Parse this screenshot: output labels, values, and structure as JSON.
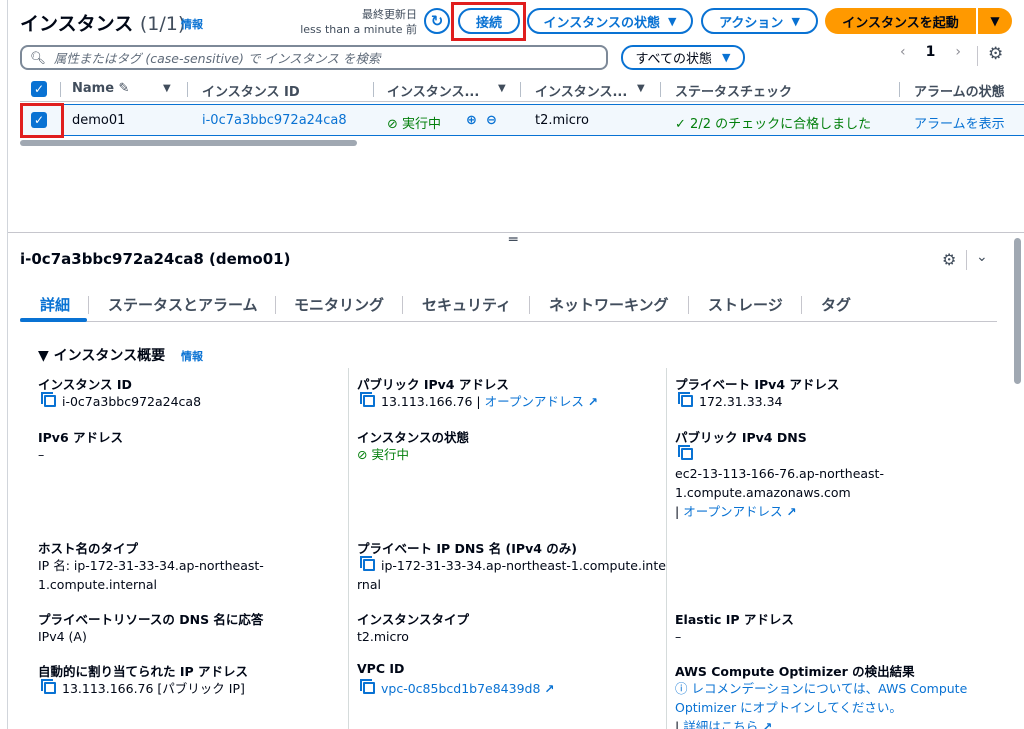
{
  "header": {
    "title": "インスタンス",
    "count": "(1/1)",
    "info": "情報",
    "last_updated_label": "最終更新日",
    "last_updated_value": "less than a minute 前",
    "connect": "接続",
    "instance_state": "インスタンスの状態",
    "actions": "アクション",
    "launch": "インスタンスを起動"
  },
  "filter": {
    "placeholder": "属性またはタグ (case-sensitive) で インスタンス を検索",
    "state_select": "すべての状態",
    "page": "1"
  },
  "table": {
    "columns": [
      "Name",
      "インスタンス ID",
      "インスタンス...",
      "インスタンス...",
      "ステータスチェック",
      "アラームの状態"
    ],
    "row": {
      "name": "demo01",
      "instance_id": "i-0c7a3bbc972a24ca8",
      "state": "実行中",
      "type": "t2.micro",
      "status_check": "2/2 のチェックに合格しました",
      "alarm": "アラームを表示"
    }
  },
  "detail": {
    "title": "i-0c7a3bbc972a24ca8 (demo01)",
    "tabs": [
      "詳細",
      "ステータスとアラーム",
      "モニタリング",
      "セキュリティ",
      "ネットワーキング",
      "ストレージ",
      "タグ"
    ],
    "section_title": "インスタンス概要",
    "section_info": "情報",
    "fields": {
      "instance_id_label": "インスタンス ID",
      "instance_id_value": "i-0c7a3bbc972a24ca8",
      "public_ipv4_label": "パブリック IPv4 アドレス",
      "public_ipv4_value": "13.113.166.76",
      "open_address": "オープンアドレス",
      "private_ipv4_label": "プライベート IPv4 アドレス",
      "private_ipv4_value": "172.31.33.34",
      "ipv6_label": "IPv6 アドレス",
      "ipv6_value": "–",
      "instance_state_label": "インスタンスの状態",
      "instance_state_value": "実行中",
      "public_dns_label": "パブリック IPv4 DNS",
      "public_dns_value_1": "ec2-13-113-166-76.ap-northeast-",
      "public_dns_value_2": "1.compute.amazonaws.com",
      "public_dns_open": "オープンアドレス",
      "hostname_type_label": "ホスト名のタイプ",
      "hostname_type_value_1": "IP 名: ip-172-31-33-34.ap-northeast-",
      "hostname_type_value_2": "1.compute.internal",
      "private_dns_label": "プライベート IP DNS 名 (IPv4 のみ)",
      "private_dns_value_1": "ip-172-31-33-34.ap-northeast-1.compute.inte",
      "private_dns_value_2": "rnal",
      "private_resource_dns_label": "プライベートリソースの DNS 名に応答",
      "private_resource_dns_value": "IPv4 (A)",
      "instance_type_label": "インスタンスタイプ",
      "instance_type_value": "t2.micro",
      "elastic_ip_label": "Elastic IP アドレス",
      "elastic_ip_value": "–",
      "auto_ip_label": "自動的に割り当てられた IP アドレス",
      "auto_ip_value": "13.113.166.76 [パブリック IP]",
      "vpc_label": "VPC ID",
      "vpc_value": "vpc-0c85bcd1b7e8439d8",
      "optimizer_label": "AWS Compute Optimizer の検出結果",
      "optimizer_value_1": "レコメンデーションについては、AWS Compute",
      "optimizer_value_2": "Optimizer にオプトインしてください。",
      "optimizer_more": "詳細はこちら"
    }
  }
}
